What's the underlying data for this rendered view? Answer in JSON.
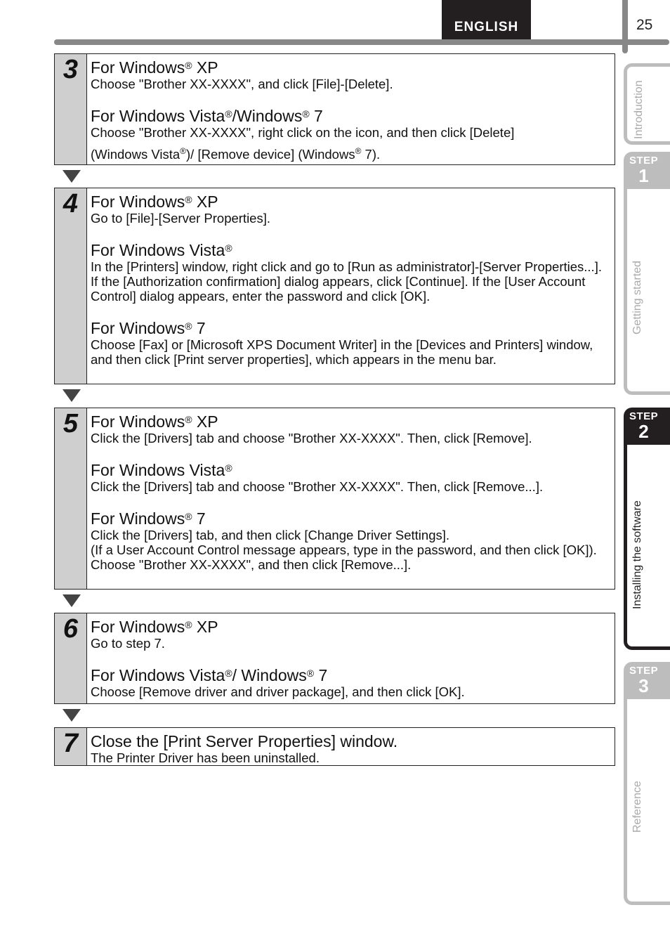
{
  "header": {
    "language": "ENGLISH",
    "page_number": "25"
  },
  "side_tabs": [
    {
      "label": "Introduction",
      "step": null,
      "active": false
    },
    {
      "step_word": "STEP",
      "step": "1",
      "label": "Getting started",
      "active": false
    },
    {
      "step_word": "STEP",
      "step": "2",
      "label": "Installing the software",
      "active": true
    },
    {
      "step_word": "STEP",
      "step": "3",
      "label": "Reference",
      "active": false
    }
  ],
  "steps": [
    {
      "number": "3",
      "sections": [
        {
          "heading": "For Windows",
          "reg": "®",
          "heading_tail": " XP",
          "lines": [
            "Choose \"Brother XX-XXXX\", and click [File]-[Delete]."
          ]
        },
        {
          "heading": "For Windows Vista",
          "reg": "®",
          "heading_mid": "/Windows",
          "reg2": "®",
          "heading_tail": " 7",
          "lines": [
            "Choose \"Brother XX-XXXX\", right click on the icon, and then click [Delete]"
          ],
          "line2_a": "(Windows Vista",
          "line2_b": ")/ [Remove device] (Windows",
          "line2_c": " 7)."
        }
      ]
    },
    {
      "number": "4",
      "sections": [
        {
          "heading": "For Windows",
          "reg": "®",
          "heading_tail": " XP",
          "lines": [
            "Go to [File]-[Server Properties]."
          ]
        },
        {
          "heading": "For Windows Vista",
          "reg": "®",
          "heading_tail": "",
          "lines": [
            "In the [Printers] window, right click and go to [Run as administrator]-[Server Properties...].",
            "If the [Authorization confirmation] dialog appears, click [Continue]. If the [User Account Control] dialog appears, enter the password and click [OK]."
          ]
        },
        {
          "heading": "For Windows",
          "reg": "®",
          "heading_tail": " 7",
          "lines": [
            "Choose [Fax] or [Microsoft XPS Document Writer] in the [Devices and Printers] window, and then click [Print server properties], which appears in the menu bar."
          ]
        }
      ]
    },
    {
      "number": "5",
      "sections": [
        {
          "heading": "For Windows",
          "reg": "®",
          "heading_tail": " XP",
          "lines": [
            "Click the [Drivers] tab and choose \"Brother XX-XXXX\". Then, click [Remove]."
          ]
        },
        {
          "heading": "For Windows Vista",
          "reg": "®",
          "heading_tail": "",
          "lines": [
            "Click the [Drivers] tab and choose \"Brother XX-XXXX\". Then, click [Remove...]."
          ]
        },
        {
          "heading": "For Windows",
          "reg": "®",
          "heading_tail": " 7",
          "lines": [
            "Click the [Drivers] tab, and then click [Change Driver Settings].",
            "(If a User Account Control message appears, type in the password, and then click [OK]).",
            "Choose \"Brother XX-XXXX\", and then click [Remove...]."
          ]
        }
      ]
    },
    {
      "number": "6",
      "sections": [
        {
          "heading": "For Windows",
          "reg": "®",
          "heading_tail": " XP",
          "lines": [
            "Go to step 7."
          ]
        },
        {
          "heading": "For Windows Vista",
          "reg": "®",
          "heading_mid": "/ Windows",
          "reg2": "®",
          "heading_tail": " 7",
          "lines": [
            "Choose [Remove driver and driver package], and then click [OK]."
          ]
        }
      ]
    },
    {
      "number": "7",
      "sections": [
        {
          "heading": "Close the [Print Server Properties] window.",
          "lines": [
            "The Printer Driver has been uninstalled."
          ]
        }
      ]
    }
  ]
}
